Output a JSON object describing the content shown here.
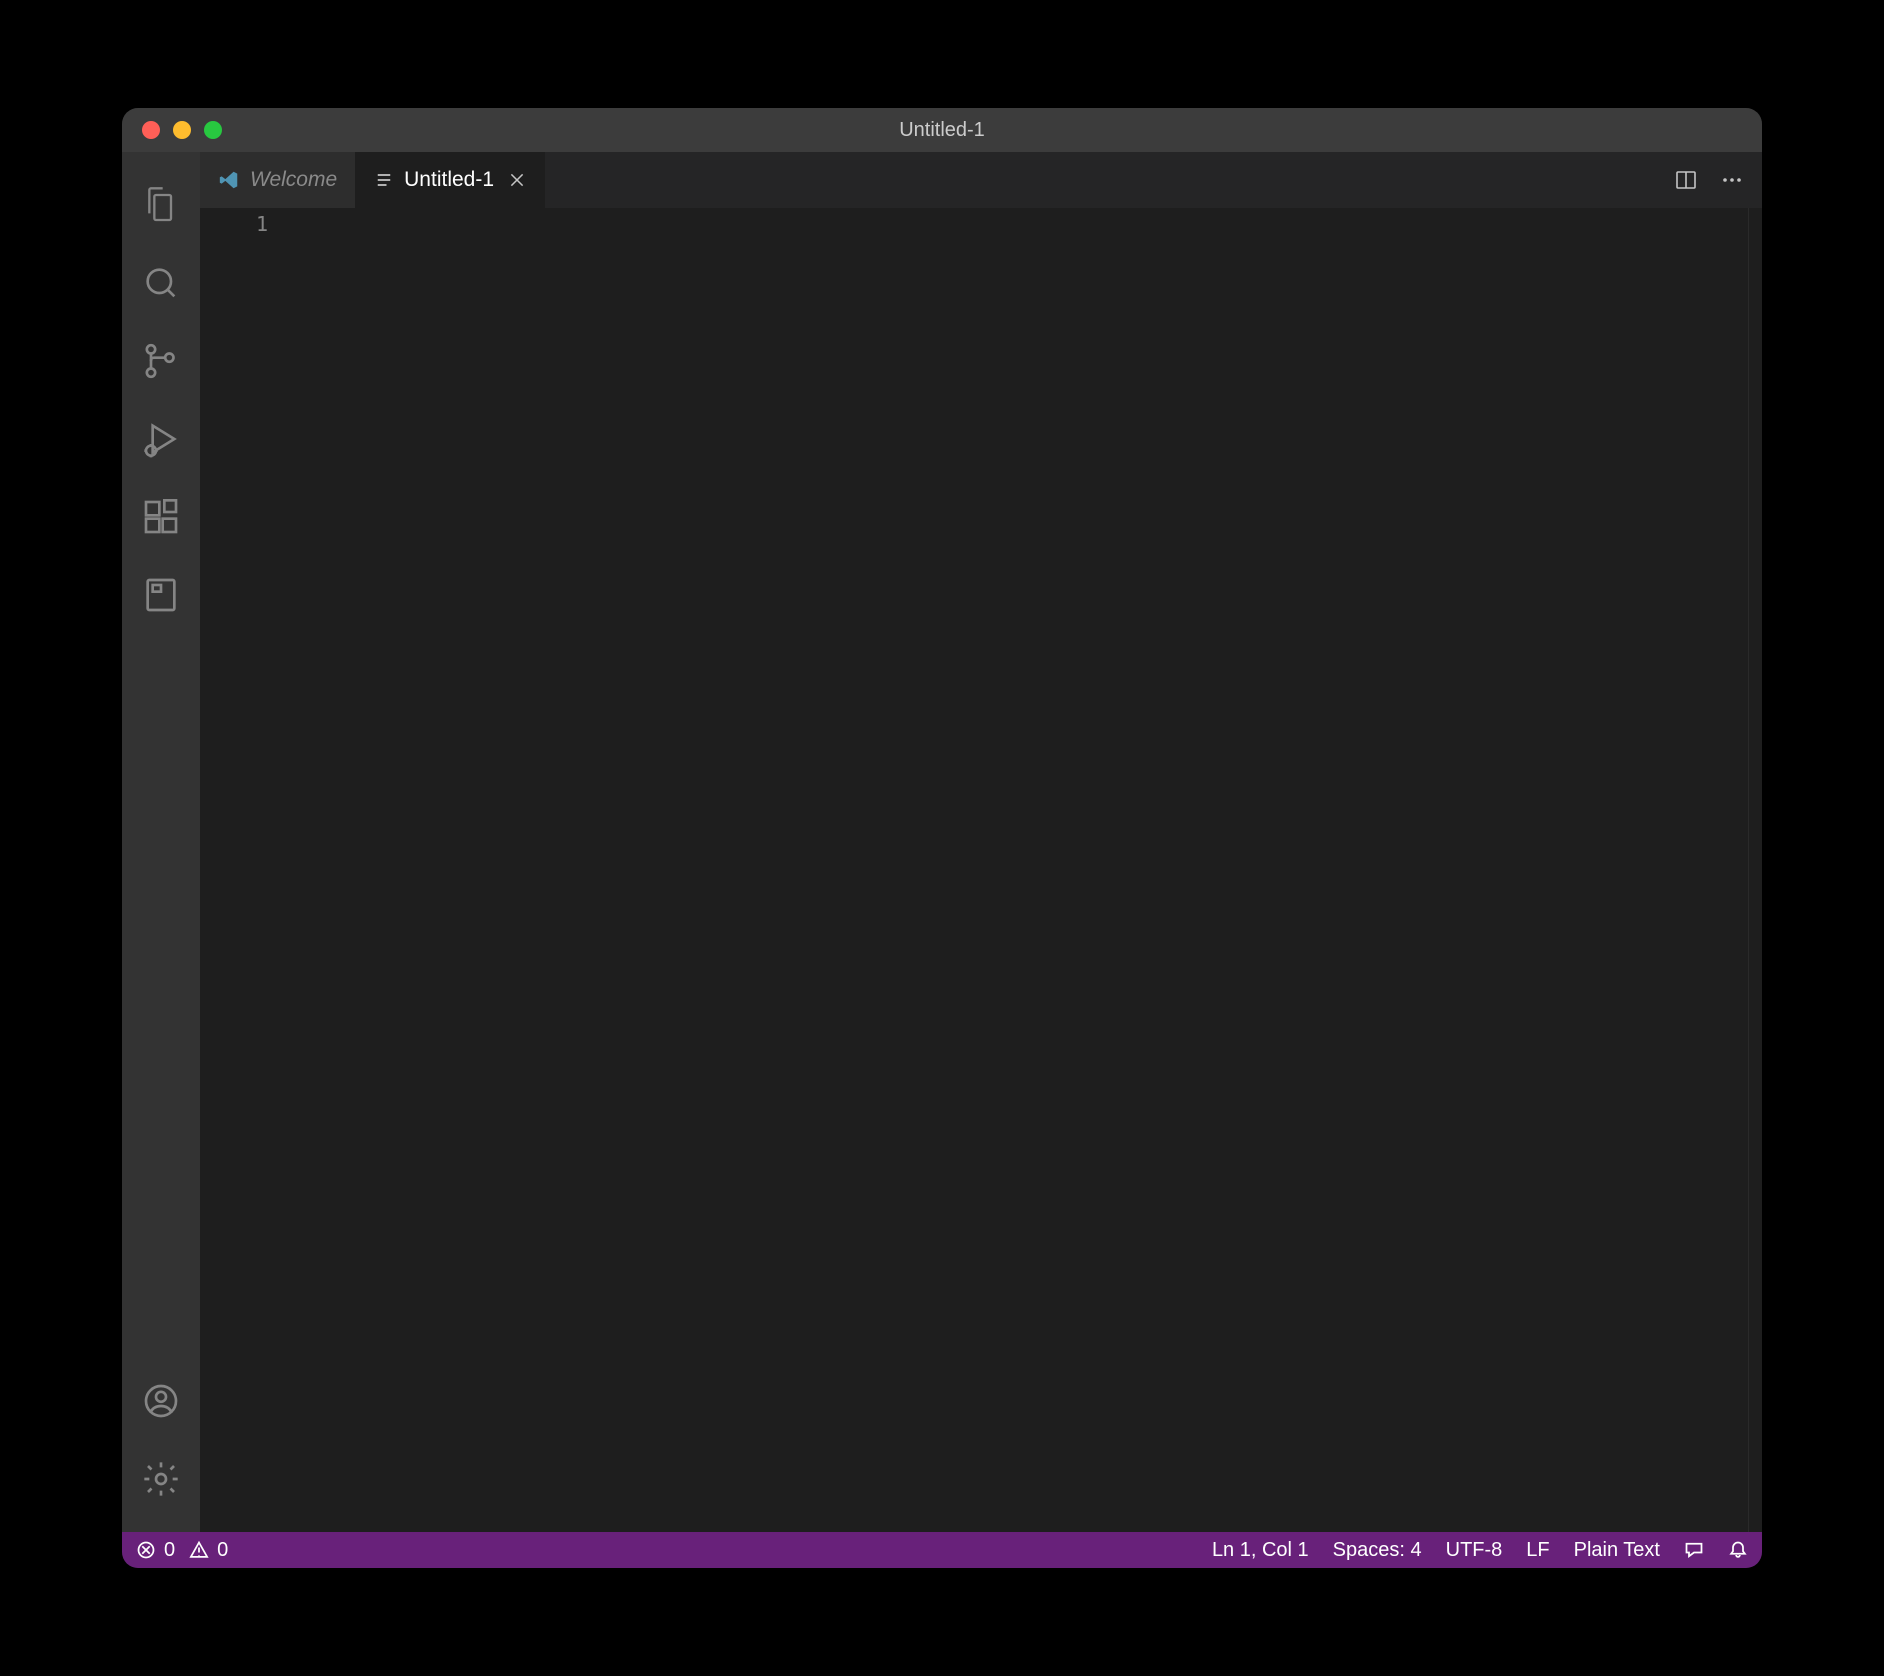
{
  "window": {
    "title": "Untitled-1"
  },
  "tabs": [
    {
      "label": "Welcome",
      "active": false
    },
    {
      "label": "Untitled-1",
      "active": true
    }
  ],
  "editor": {
    "lineNumbers": [
      "1"
    ]
  },
  "statusbar": {
    "errors": "0",
    "warnings": "0",
    "cursor": "Ln 1, Col 1",
    "indentation": "Spaces: 4",
    "encoding": "UTF-8",
    "eol": "LF",
    "language": "Plain Text"
  }
}
